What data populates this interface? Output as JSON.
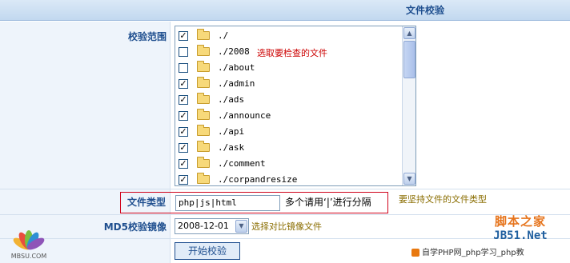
{
  "header": {
    "title": "文件校验"
  },
  "scope": {
    "label": "校验范围",
    "annotation": "选取要检查的文件",
    "items": [
      {
        "path": "./",
        "checked": true
      },
      {
        "path": "./2008",
        "checked": false
      },
      {
        "path": "./about",
        "checked": false
      },
      {
        "path": "./admin",
        "checked": true
      },
      {
        "path": "./ads",
        "checked": true
      },
      {
        "path": "./announce",
        "checked": true
      },
      {
        "path": "./api",
        "checked": true
      },
      {
        "path": "./ask",
        "checked": true
      },
      {
        "path": "./comment",
        "checked": true
      },
      {
        "path": "./corpandresize",
        "checked": true
      }
    ]
  },
  "file_type": {
    "label": "文件类型",
    "value": "php|js|html",
    "hint": "多个请用‘|’进行分隔",
    "note": "要坚持文件的文件类型"
  },
  "md5": {
    "label": "MD5校验镜像",
    "selected": "2008-12-01",
    "note": "选择对比镜像文件"
  },
  "submit": {
    "label": "开始校验"
  },
  "watermarks": {
    "jb51_cn": "脚本之家",
    "jb51_en": "JB51.Net",
    "php": "自学PHP网_php学习_php教",
    "logo": "MBSU.COM"
  },
  "colors": {
    "accent": "#1f4f8f",
    "label_bg": "#eef4fb",
    "annotation_red": "#cc0000",
    "note_olive": "#8a6d00",
    "highlight_border": "#d0021b"
  }
}
